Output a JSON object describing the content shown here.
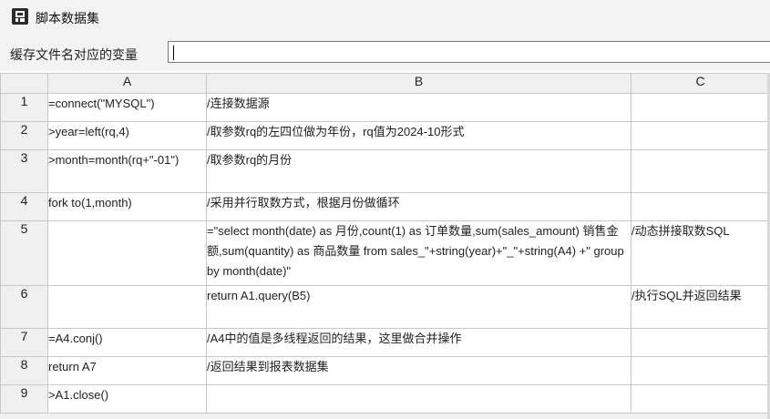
{
  "window": {
    "title": "脚本数据集"
  },
  "variable": {
    "label": "缓存文件名对应的变量",
    "value": ""
  },
  "grid": {
    "columns": [
      "A",
      "B",
      "C"
    ],
    "rows": [
      {
        "num": "1",
        "A": "=connect(\"MYSQL\")",
        "B": "/连接数据源",
        "C": ""
      },
      {
        "num": "2",
        "A": ">year=left(rq,4)",
        "B": "/取参数rq的左四位做为年份，rq值为2024-10形式",
        "C": ""
      },
      {
        "num": "3",
        "A": ">month=month(rq+\"-01\")",
        "B": "/取参数rq的月份",
        "C": ""
      },
      {
        "num": "4",
        "A": "fork to(1,month)",
        "B": "/采用并行取数方式，根据月份做循环",
        "C": ""
      },
      {
        "num": "5",
        "A": "",
        "B": "=\"select month(date) as 月份,count(1) as 订单数量,sum(sales_amount) 销售金额,sum(quantity) as 商品数量 from sales_\"+string(year)+\"_\"+string(A4) +\" group by month(date)\"",
        "C": "/动态拼接取数SQL"
      },
      {
        "num": "6",
        "A": "",
        "B": "return A1.query(B5)",
        "C": "/执行SQL并返回结果"
      },
      {
        "num": "7",
        "A": "=A4.conj()",
        "B": "/A4中的值是多线程返回的结果，这里做合并操作",
        "C": ""
      },
      {
        "num": "8",
        "A": "return A7",
        "B": "/返回结果到报表数据集",
        "C": ""
      },
      {
        "num": "9",
        "A": ">A1.close()",
        "B": "",
        "C": ""
      }
    ]
  }
}
